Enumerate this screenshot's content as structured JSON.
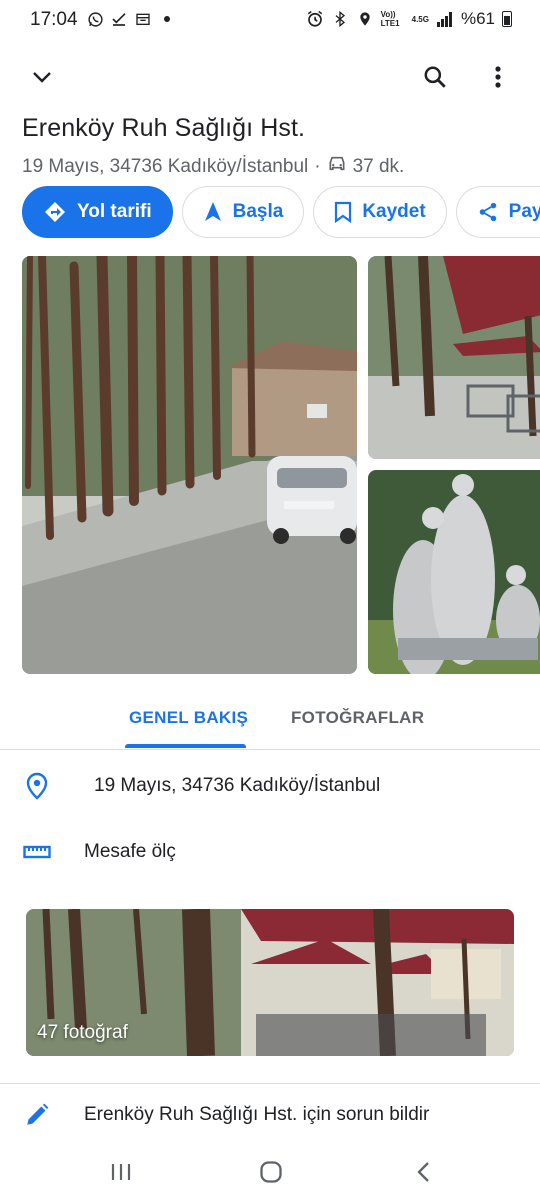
{
  "status": {
    "time": "17:04",
    "network": "Vo)) LTE1",
    "network_type": "4.5G",
    "battery": "%61"
  },
  "place": {
    "name": "Erenköy Ruh Sağlığı Hst.",
    "address_short": "19 Mayıs, 34736 Kadıköy/İstanbul",
    "separator": "·",
    "drive_time": "37 dk."
  },
  "actions": {
    "directions": "Yol tarifi",
    "start": "Başla",
    "save": "Kaydet",
    "share": "Paylaş"
  },
  "tabs": {
    "overview": "GENEL BAKIŞ",
    "photos": "FOTOĞRAFLAR"
  },
  "details": {
    "address": "19 Mayıs, 34736 Kadıköy/İstanbul",
    "measure": "Mesafe ölç"
  },
  "gallery": {
    "count_label": "47 fotoğraf"
  },
  "report": {
    "label": "Erenköy Ruh Sağlığı Hst. için sorun bildir"
  },
  "colors": {
    "accent": "#1a73e8",
    "text": "#202124",
    "secondary": "#5f6368"
  }
}
